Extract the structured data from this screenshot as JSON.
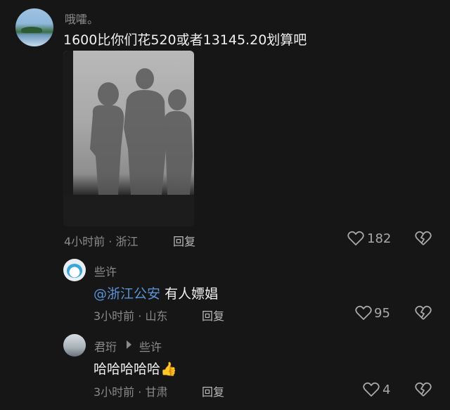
{
  "comments": [
    {
      "username": "哦嚯。",
      "text": "1600比你们花520或者13145.20划算吧",
      "time_location": "4小时前 · 浙江",
      "reply_label": "回复",
      "likes": "182"
    },
    {
      "username": "些许",
      "mention": "@浙江公安",
      "text": "有人嫖娼",
      "time_location": "3小时前 · 山东",
      "reply_label": "回复",
      "likes": "95"
    },
    {
      "username": "君珩",
      "reply_to": "些许",
      "text": "哈哈哈哈哈",
      "emoji": "👍",
      "time_location": "3小时前 · 甘肃",
      "reply_label": "回复",
      "likes": "4"
    }
  ],
  "icons": {
    "like": "heart-outline-icon",
    "dislike": "broken-heart-icon",
    "reply_arrow": "triangle-right-icon"
  },
  "colors": {
    "background": "#161616",
    "mention": "#5a93d6",
    "muted_text": "#8a8a8a"
  }
}
